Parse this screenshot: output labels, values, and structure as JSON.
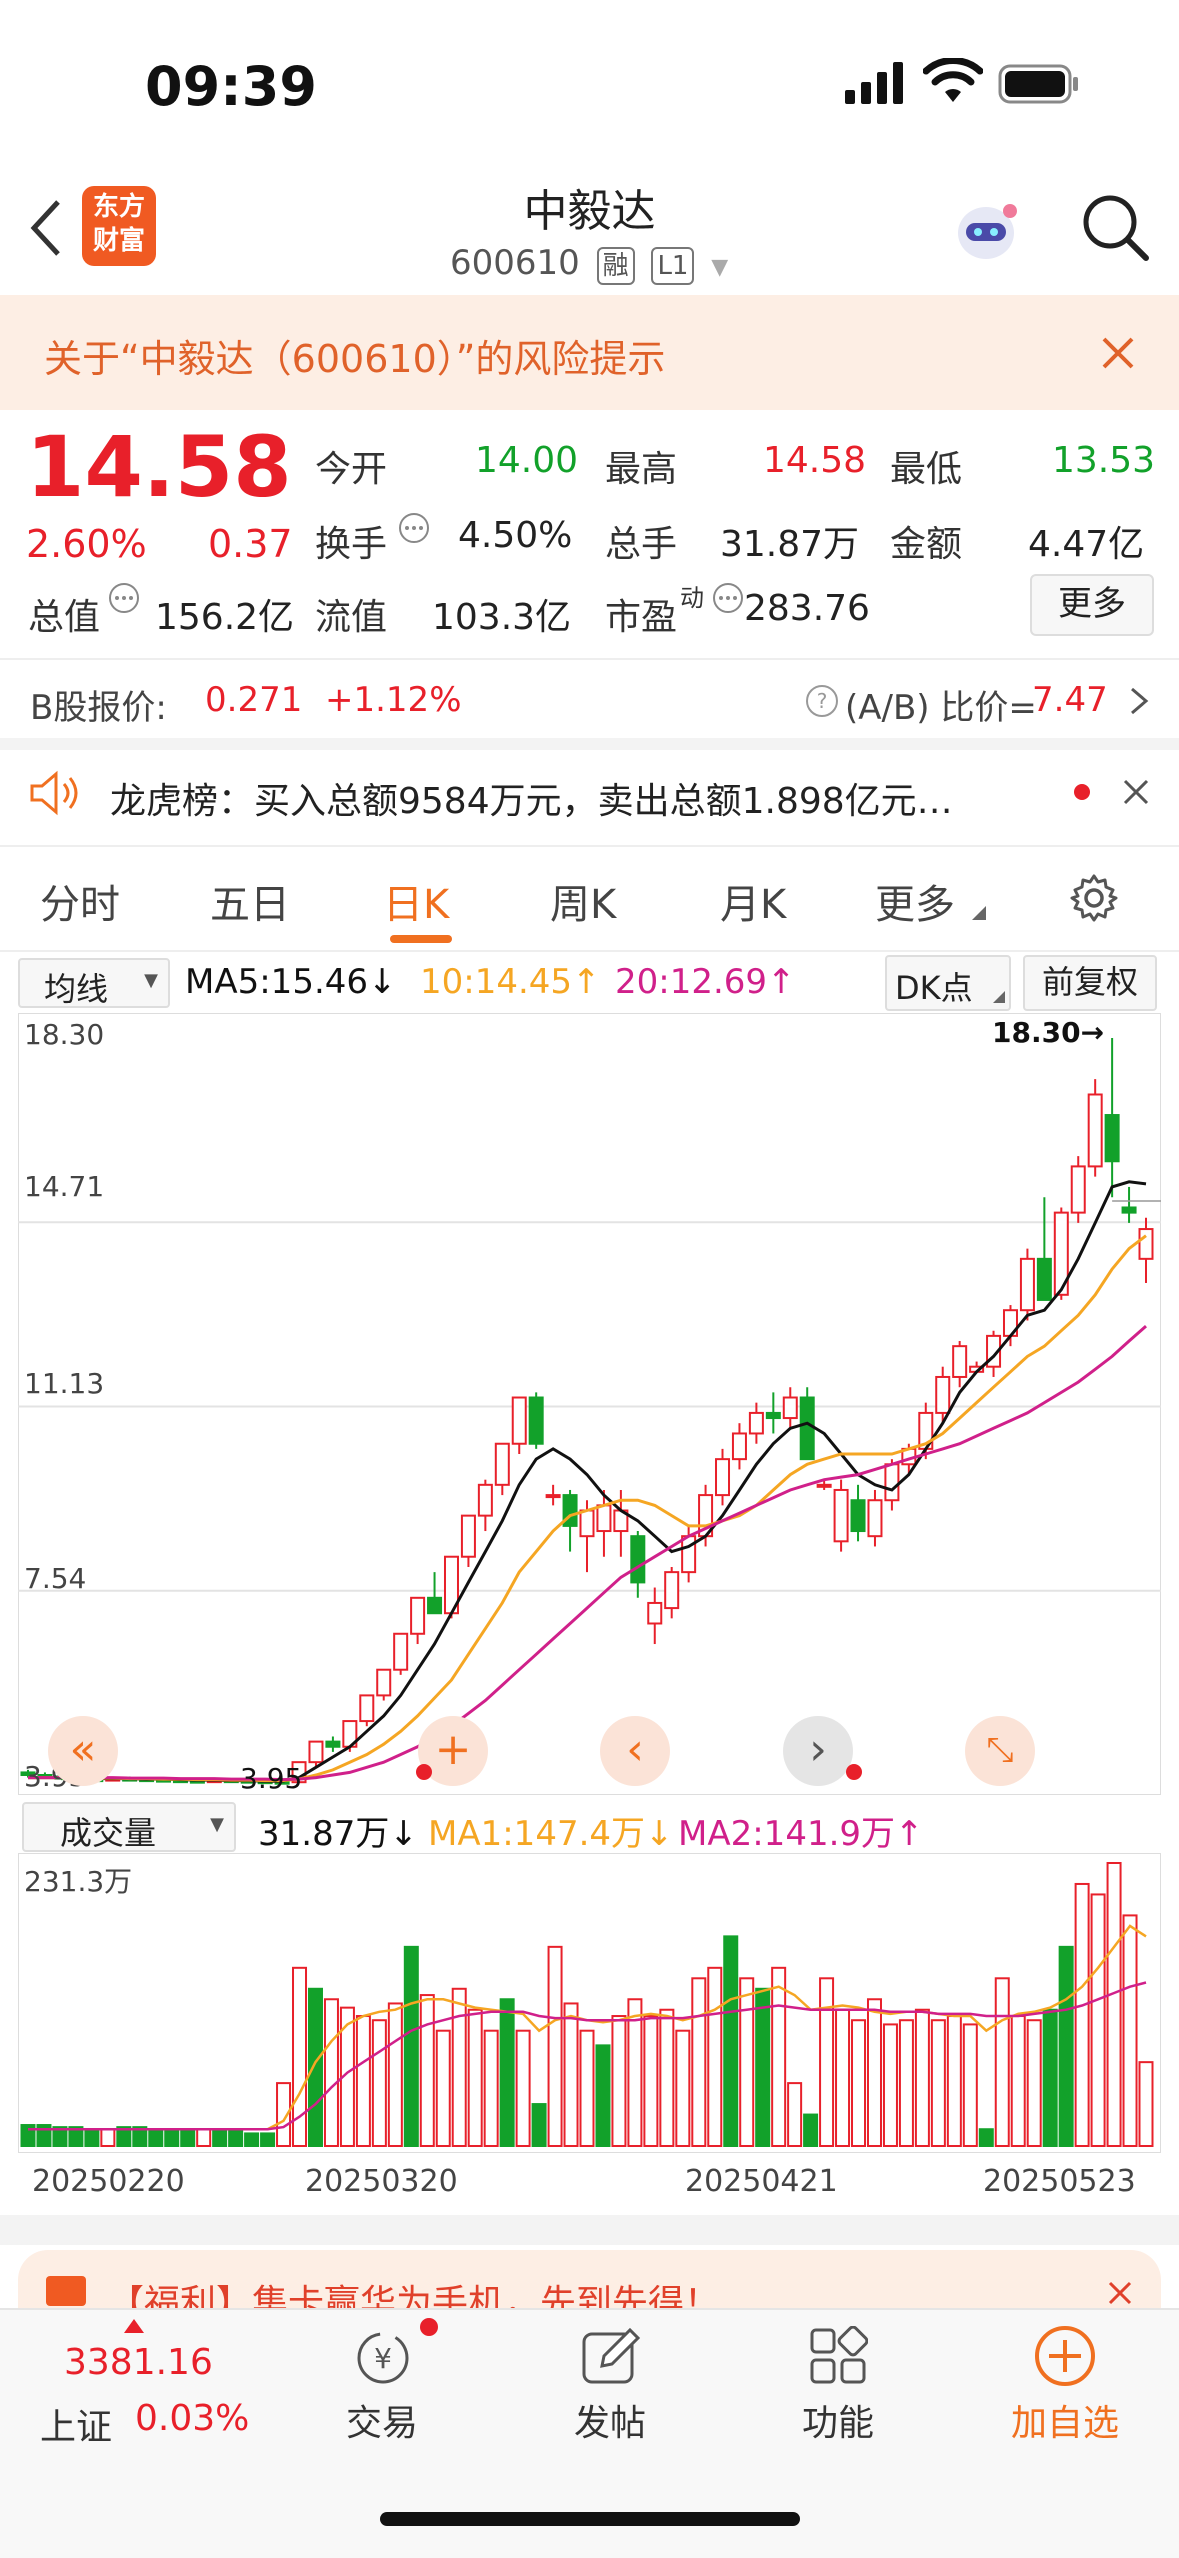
{
  "status": {
    "time": "09:39"
  },
  "header": {
    "brand_line1": "东方",
    "brand_line2": "财富",
    "title": "中毅达",
    "code": "600610",
    "tag1": "融",
    "tag2": "L1"
  },
  "risk": {
    "text": "关于“中毅达（600610）”的风险提示"
  },
  "quote": {
    "price": "14.58",
    "change_pct": "2.60%",
    "change": "0.37",
    "open_label": "今开",
    "open": "14.00",
    "high_label": "最高",
    "high": "14.58",
    "low_label": "最低",
    "low": "13.53",
    "turnover_label": "换手",
    "turnover": "4.50%",
    "volume_label": "总手",
    "volume": "31.87万",
    "amount_label": "金额",
    "amount": "4.47亿",
    "mktcap_label": "总值",
    "mktcap": "156.2亿",
    "float_label": "流值",
    "float": "103.3亿",
    "pe_label": "市盈",
    "pe_sup": "动",
    "pe": "283.76",
    "more_button": "更多"
  },
  "bshare": {
    "label": "B股报价:",
    "price": "0.271",
    "change": "+1.12%",
    "ratio_label": "(A/B) 比价=",
    "ratio": "7.47"
  },
  "dragon": {
    "text": "龙虎榜：买入总额9584万元，卖出总额1.898亿元…"
  },
  "tabs": [
    "分时",
    "五日",
    "日K",
    "周K",
    "月K",
    "更多"
  ],
  "active_tab": 2,
  "kline": {
    "ma_select": "均线",
    "ma5": "MA5:15.46↓",
    "ma10": "10:14.45↑",
    "ma20": "20:12.69↑",
    "dk_button": "DK点",
    "fq_button": "前复权",
    "y_labels": [
      "18.30",
      "14.71",
      "11.13",
      "7.54",
      "3.95"
    ],
    "max_marker": "18.30→",
    "min_marker": "3.95"
  },
  "volume": {
    "select": "成交量",
    "current": "31.87万↓",
    "ma1": "MA1:147.4万↓",
    "ma2": "MA2:141.9万↑",
    "y_label": "231.3万",
    "dates": [
      "20250220",
      "20250320",
      "20250421",
      "20250523"
    ]
  },
  "promo": {
    "text": "【福利】集卡赢华为手机，先到先得！"
  },
  "bottom": {
    "index_value": "3381.16",
    "index_name": "上证",
    "index_change": "0.03%",
    "trade": "交易",
    "post": "发帖",
    "function": "功能",
    "add": "加自选"
  },
  "colors": {
    "up": "#e8202a",
    "down": "#12a12a",
    "accent": "#f07020",
    "ma5": "#111111",
    "ma10": "#f5a623",
    "ma20": "#d0208a"
  },
  "chart_data": {
    "type": "candlestick",
    "y_range": [
      3.95,
      18.3
    ],
    "candles": [
      [
        4.0,
        4.05,
        3.9,
        3.95
      ],
      [
        3.95,
        4.0,
        3.9,
        3.92
      ],
      [
        3.92,
        3.96,
        3.85,
        3.88
      ],
      [
        3.88,
        3.92,
        3.85,
        3.87
      ],
      [
        3.87,
        3.9,
        3.84,
        3.86
      ],
      [
        3.86,
        3.9,
        3.84,
        3.88
      ],
      [
        3.88,
        3.92,
        3.85,
        3.87
      ],
      [
        3.87,
        3.9,
        3.85,
        3.86
      ],
      [
        3.86,
        3.9,
        3.84,
        3.85
      ],
      [
        3.85,
        3.88,
        3.83,
        3.84
      ],
      [
        3.84,
        3.87,
        3.82,
        3.83
      ],
      [
        3.83,
        3.86,
        3.82,
        3.85
      ],
      [
        3.85,
        3.88,
        3.83,
        3.84
      ],
      [
        3.84,
        3.86,
        3.82,
        3.83
      ],
      [
        3.83,
        3.85,
        3.8,
        3.82
      ],
      [
        3.82,
        3.84,
        3.8,
        3.81
      ],
      [
        3.81,
        4.2,
        3.8,
        4.2
      ],
      [
        4.2,
        4.6,
        4.1,
        4.6
      ],
      [
        4.6,
        4.7,
        4.4,
        4.5
      ],
      [
        4.5,
        5.0,
        4.4,
        5.0
      ],
      [
        5.0,
        5.5,
        4.9,
        5.5
      ],
      [
        5.5,
        6.0,
        5.4,
        6.0
      ],
      [
        6.0,
        6.7,
        5.9,
        6.7
      ],
      [
        6.7,
        7.4,
        6.5,
        7.4
      ],
      [
        7.4,
        7.9,
        7.1,
        7.1
      ],
      [
        7.1,
        8.2,
        7.0,
        8.2
      ],
      [
        8.2,
        9.0,
        8.0,
        9.0
      ],
      [
        9.0,
        9.7,
        8.7,
        9.6
      ],
      [
        9.6,
        10.4,
        9.4,
        10.4
      ],
      [
        10.4,
        11.3,
        10.2,
        11.3
      ],
      [
        11.3,
        11.4,
        10.3,
        10.4
      ],
      [
        9.4,
        9.6,
        9.2,
        9.4
      ],
      [
        9.4,
        9.5,
        8.3,
        8.8
      ],
      [
        8.6,
        9.3,
        7.9,
        9.1
      ],
      [
        8.7,
        9.5,
        8.2,
        9.2
      ],
      [
        8.7,
        9.5,
        8.2,
        9.1
      ],
      [
        8.6,
        8.7,
        7.4,
        7.7
      ],
      [
        6.9,
        7.6,
        6.5,
        7.3
      ],
      [
        7.2,
        8.0,
        7.0,
        7.9
      ],
      [
        7.9,
        8.8,
        7.7,
        8.6
      ],
      [
        8.6,
        9.6,
        8.4,
        9.4
      ],
      [
        9.4,
        10.3,
        9.2,
        10.1
      ],
      [
        10.1,
        10.8,
        9.9,
        10.6
      ],
      [
        10.6,
        11.2,
        10.4,
        11.0
      ],
      [
        11.0,
        11.4,
        10.6,
        10.9
      ],
      [
        10.9,
        11.5,
        10.7,
        11.3
      ],
      [
        11.3,
        11.5,
        10.1,
        10.1
      ],
      [
        9.6,
        9.7,
        9.5,
        9.6
      ],
      [
        8.5,
        9.7,
        8.3,
        9.5
      ],
      [
        9.3,
        9.6,
        8.5,
        8.7
      ],
      [
        8.6,
        9.5,
        8.4,
        9.3
      ],
      [
        9.3,
        10.1,
        9.1,
        10.0
      ],
      [
        10.0,
        10.4,
        9.8,
        10.3
      ],
      [
        10.3,
        11.2,
        10.1,
        11.0
      ],
      [
        11.0,
        11.9,
        10.8,
        11.7
      ],
      [
        11.7,
        12.4,
        11.5,
        12.3
      ],
      [
        11.8,
        12.0,
        11.8,
        11.9
      ],
      [
        11.9,
        12.6,
        11.7,
        12.5
      ],
      [
        12.5,
        13.1,
        12.3,
        13.0
      ],
      [
        13.0,
        14.2,
        12.8,
        14.0
      ],
      [
        14.0,
        15.2,
        13.6,
        13.2
      ],
      [
        13.3,
        15.0,
        13.2,
        14.9
      ],
      [
        14.9,
        16.0,
        14.7,
        15.8
      ],
      [
        15.8,
        17.5,
        15.6,
        17.2
      ],
      [
        16.8,
        18.3,
        15.2,
        15.9
      ],
      [
        15.0,
        15.4,
        14.7,
        14.9
      ],
      [
        14.0,
        14.8,
        13.53,
        14.58
      ]
    ],
    "ma5": [
      3.9,
      3.9,
      3.9,
      3.9,
      3.88,
      3.88,
      3.88,
      3.87,
      3.87,
      3.86,
      3.85,
      3.85,
      3.84,
      3.84,
      3.83,
      3.83,
      3.9,
      4.1,
      4.3,
      4.5,
      4.8,
      5.1,
      5.5,
      6.0,
      6.5,
      7.1,
      7.7,
      8.3,
      8.9,
      9.6,
      10.1,
      10.3,
      10.1,
      9.8,
      9.4,
      9.1,
      8.9,
      8.6,
      8.3,
      8.4,
      8.6,
      9.0,
      9.5,
      10.0,
      10.4,
      10.7,
      10.8,
      10.6,
      10.2,
      9.8,
      9.6,
      9.5,
      9.8,
      10.3,
      10.8,
      11.4,
      11.8,
      12.1,
      12.5,
      12.9,
      13.0,
      13.4,
      14.0,
      14.7,
      15.4,
      15.5,
      15.46
    ],
    "ma10": [
      3.9,
      3.9,
      3.9,
      3.9,
      3.89,
      3.89,
      3.88,
      3.88,
      3.87,
      3.87,
      3.86,
      3.86,
      3.85,
      3.85,
      3.84,
      3.84,
      3.87,
      3.95,
      4.05,
      4.2,
      4.35,
      4.55,
      4.8,
      5.1,
      5.45,
      5.8,
      6.3,
      6.8,
      7.3,
      7.9,
      8.3,
      8.7,
      9.0,
      9.1,
      9.2,
      9.3,
      9.3,
      9.2,
      9.0,
      8.8,
      8.8,
      8.9,
      9.0,
      9.2,
      9.5,
      9.8,
      10.0,
      10.1,
      10.2,
      10.2,
      10.2,
      10.2,
      10.3,
      10.4,
      10.6,
      10.9,
      11.2,
      11.5,
      11.8,
      12.1,
      12.3,
      12.6,
      12.9,
      13.3,
      13.8,
      14.2,
      14.45
    ],
    "ma20": [
      3.9,
      3.9,
      3.9,
      3.9,
      3.9,
      3.9,
      3.89,
      3.89,
      3.89,
      3.88,
      3.88,
      3.88,
      3.87,
      3.87,
      3.87,
      3.86,
      3.87,
      3.9,
      3.95,
      4.0,
      4.1,
      4.2,
      4.35,
      4.5,
      4.7,
      4.9,
      5.15,
      5.4,
      5.7,
      6.0,
      6.3,
      6.6,
      6.9,
      7.2,
      7.5,
      7.8,
      8.0,
      8.2,
      8.4,
      8.6,
      8.75,
      8.9,
      9.05,
      9.2,
      9.35,
      9.5,
      9.6,
      9.7,
      9.75,
      9.8,
      9.9,
      10.0,
      10.1,
      10.2,
      10.3,
      10.4,
      10.55,
      10.7,
      10.85,
      11.0,
      11.2,
      11.4,
      11.6,
      11.85,
      12.1,
      12.4,
      12.69
    ],
    "volumes": [
      10,
      10,
      9,
      9,
      8,
      8,
      9,
      9,
      8,
      7,
      7,
      8,
      7,
      7,
      6,
      6,
      30,
      85,
      75,
      70,
      66,
      62,
      60,
      68,
      95,
      72,
      55,
      75,
      65,
      55,
      70,
      55,
      20,
      95,
      68,
      55,
      48,
      62,
      70,
      62,
      65,
      55,
      80,
      85,
      100,
      80,
      75,
      85,
      30,
      15,
      80,
      65,
      60,
      70,
      58,
      60,
      65,
      60,
      62,
      58,
      8,
      80,
      62,
      60,
      65,
      95,
      125,
      120,
      135,
      110,
      40
    ],
    "vol_ma1": [
      8,
      8,
      8,
      8,
      8,
      8,
      8,
      8,
      8,
      8,
      8,
      8,
      8,
      8,
      8,
      8,
      12,
      25,
      40,
      50,
      58,
      62,
      64,
      65,
      68,
      70,
      70,
      68,
      66,
      65,
      64,
      63,
      55,
      60,
      62,
      60,
      59,
      60,
      62,
      63,
      62,
      60,
      62,
      65,
      70,
      72,
      74,
      76,
      72,
      65,
      66,
      67,
      66,
      64,
      63,
      64,
      64,
      63,
      62,
      62,
      55,
      60,
      63,
      64,
      66,
      70,
      76,
      85,
      95,
      105,
      100
    ],
    "vol_ma2": [
      8,
      8,
      8,
      8,
      8,
      8,
      8,
      8,
      8,
      8,
      8,
      8,
      8,
      8,
      8,
      8,
      9,
      14,
      20,
      28,
      35,
      40,
      45,
      50,
      55,
      58,
      60,
      62,
      63,
      64,
      64,
      64,
      62,
      61,
      61,
      60,
      60,
      60,
      60,
      61,
      61,
      61,
      62,
      63,
      64,
      65,
      66,
      67,
      66,
      65,
      65,
      65,
      65,
      65,
      64,
      64,
      64,
      63,
      63,
      63,
      62,
      62,
      62,
      63,
      64,
      65,
      67,
      70,
      73,
      76,
      78
    ]
  }
}
